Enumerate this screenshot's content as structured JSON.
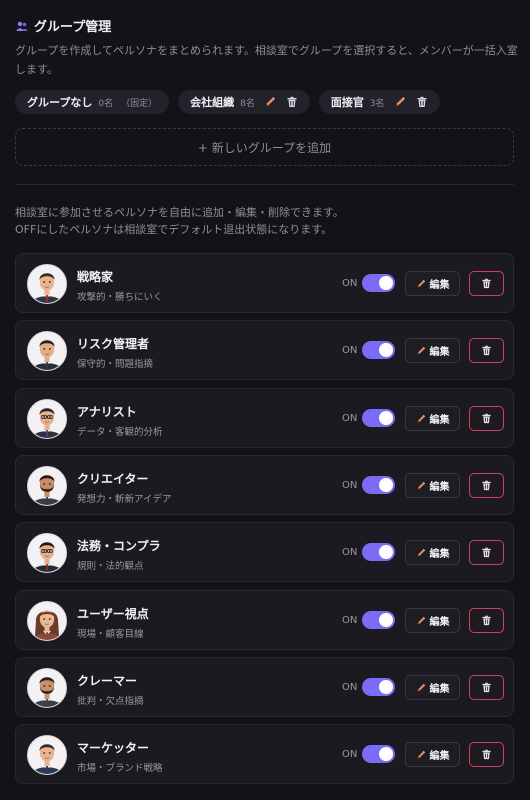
{
  "group_section": {
    "title": "グループ管理",
    "description": "グループを作成してペルソナをまとめられます。相談室でグループを選択すると、メンバーが一括入室します。",
    "groups": [
      {
        "name": "グループなし",
        "count": "0名",
        "note": "（固定）",
        "editable": false
      },
      {
        "name": "会社組織",
        "count": "8名",
        "note": "",
        "editable": true
      },
      {
        "name": "面接官",
        "count": "3名",
        "note": "",
        "editable": true
      }
    ],
    "add_label": "+ 新しいグループを追加"
  },
  "persona_section": {
    "description_line1": "相談室に参加させるペルソナを自由に追加・編集・削除できます。",
    "description_line2": "OFFにしたペルソナは相談室でデフォルト退出状態になります。",
    "on_label": "ON",
    "edit_label": "編集",
    "personas": [
      {
        "name": "戦略家",
        "subtitle": "攻撃的・勝ちにいく",
        "enabled": true
      },
      {
        "name": "リスク管理者",
        "subtitle": "保守的・問題指摘",
        "enabled": true
      },
      {
        "name": "アナリスト",
        "subtitle": "データ・客観的分析",
        "enabled": true
      },
      {
        "name": "クリエイター",
        "subtitle": "発想力・斬新アイデア",
        "enabled": true
      },
      {
        "name": "法務・コンプラ",
        "subtitle": "規則・法的観点",
        "enabled": true
      },
      {
        "name": "ユーザー視点",
        "subtitle": "現場・顧客目線",
        "enabled": true
      },
      {
        "name": "クレーマー",
        "subtitle": "批判・欠点指摘",
        "enabled": true
      },
      {
        "name": "マーケッター",
        "subtitle": "市場・ブランド戦略",
        "enabled": true
      }
    ]
  },
  "colors": {
    "background": "#141218",
    "accent_toggle": "#7b6cf5",
    "delete_border": "#c9445a",
    "edit_icon": "#f08a5d"
  },
  "icons": {
    "header": "people-icon",
    "edit": "pencil-icon",
    "delete": "trash-icon"
  }
}
